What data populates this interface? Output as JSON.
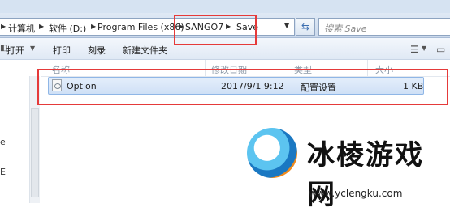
{
  "breadcrumb": {
    "items": [
      "计算机",
      "软件 (D:)",
      "Program Files (x86)",
      "SANGO7",
      "Save"
    ]
  },
  "search": {
    "placeholder": "搜索 Save"
  },
  "toolbar": {
    "open_label": "打开",
    "print_label": "打印",
    "burn_label": "刻录",
    "new_folder_label": "新建文件夹"
  },
  "columns": {
    "name": "名称",
    "modified": "修改日期",
    "type": "类型",
    "size": "大小"
  },
  "files": [
    {
      "name": "Option",
      "modified": "2017/9/1 9:12",
      "type": "配置设置",
      "size": "1 KB"
    }
  ],
  "left_pane": {
    "chars": [
      "e",
      "E"
    ]
  },
  "watermark": {
    "name": "冰棱游戏网",
    "url": "www.yclengku.com"
  },
  "colors": {
    "highlight_border": "#e53a3a",
    "selection": "#cfe0f6",
    "accent": "#3d6fb1"
  }
}
